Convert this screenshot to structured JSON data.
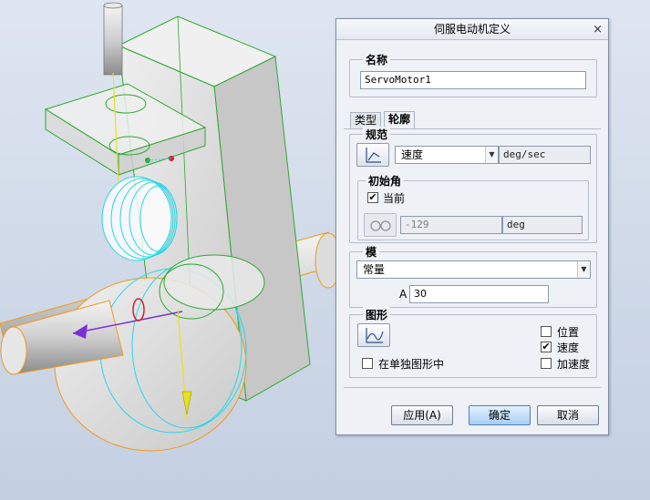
{
  "dialog": {
    "title": "伺服电动机定义",
    "close_label": "×",
    "name_group": {
      "title": "名称",
      "value": "ServoMotor1"
    },
    "tabs": [
      {
        "label": "类型",
        "active": false
      },
      {
        "label": "轮廓",
        "active": true
      }
    ],
    "spec_group": {
      "title": "规范",
      "quantity": "速度",
      "unit": "deg/sec",
      "initial_angle": {
        "title": "初始角",
        "current_checked": true,
        "current_label": "当前",
        "value": "-129",
        "unit": "deg"
      }
    },
    "model_group": {
      "title": "模",
      "type": "常量",
      "param_label": "A",
      "param_value": "30"
    },
    "graph_group": {
      "title": "图形",
      "separate_label": "在单独图形中",
      "separate_checked": false,
      "options": [
        {
          "label": "位置",
          "checked": false
        },
        {
          "label": "速度",
          "checked": true
        },
        {
          "label": "加速度",
          "checked": false
        }
      ]
    },
    "buttons": {
      "apply": "应用(A)",
      "ok": "确定",
      "cancel": "取消"
    }
  },
  "icons": {
    "spec": "spec-graph-icon",
    "initial_angle": "glasses-icon",
    "graph": "graph-icon"
  },
  "colors": {
    "model_green": "#2ea82e",
    "model_orange": "#f29a1a",
    "model_cyan": "#26d7e8",
    "model_yellow": "#e6e31a",
    "primary_button": "#a9cdf3"
  }
}
